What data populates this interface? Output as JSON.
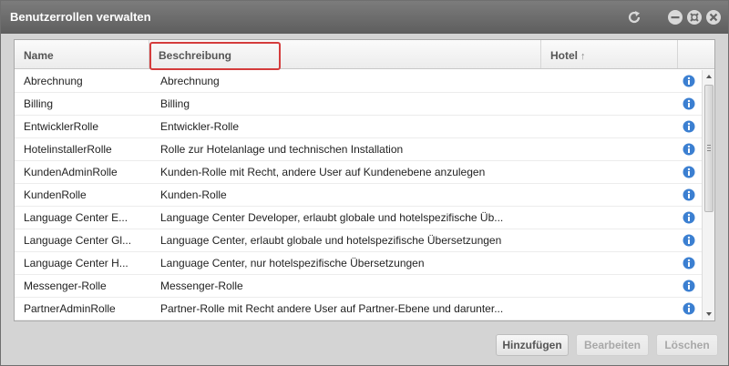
{
  "window": {
    "title": "Benutzerrollen verwalten"
  },
  "grid": {
    "columns": {
      "name": "Name",
      "description": "Beschreibung",
      "hotel": "Hotel",
      "hotel_sort": "↑"
    },
    "rows": [
      {
        "name": "Abrechnung",
        "description": "Abrechnung"
      },
      {
        "name": "Billing",
        "description": "Billing"
      },
      {
        "name": "EntwicklerRolle",
        "description": "Entwickler-Rolle"
      },
      {
        "name": "HotelinstallerRolle",
        "description": "Rolle zur Hotelanlage und technischen Installation"
      },
      {
        "name": "KundenAdminRolle",
        "description": "Kunden-Rolle mit Recht, andere User auf Kundenebene anzulegen"
      },
      {
        "name": "KundenRolle",
        "description": "Kunden-Rolle"
      },
      {
        "name": "Language Center E...",
        "description": "Language Center Developer, erlaubt globale und hotelspezifische Üb..."
      },
      {
        "name": "Language Center Gl...",
        "description": "Language Center, erlaubt globale und hotelspezifische Übersetzungen"
      },
      {
        "name": "Language Center H...",
        "description": "Language Center, nur hotelspezifische Übersetzungen"
      },
      {
        "name": "Messenger-Rolle",
        "description": "Messenger-Rolle"
      },
      {
        "name": "PartnerAdminRolle",
        "description": "Partner-Rolle mit Recht andere User auf Partner-Ebene und darunter..."
      }
    ]
  },
  "buttons": {
    "add": "Hinzufügen",
    "edit": "Bearbeiten",
    "delete": "Löschen"
  },
  "colors": {
    "titlebar": "#6b6b6b",
    "highlight": "#d43c3c",
    "info_icon": "#3b7fd1"
  },
  "icons": {
    "refresh": "refresh-icon",
    "minimize": "minimize-icon",
    "maximize": "maximize-icon",
    "close": "close-icon",
    "info": "info-icon"
  }
}
